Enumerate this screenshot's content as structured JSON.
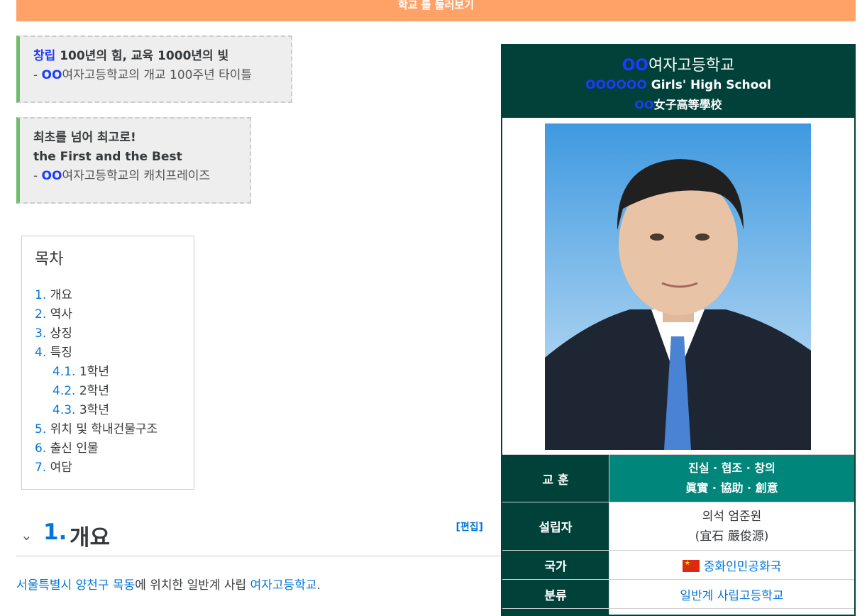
{
  "top_bar": {
    "label": "학교 를 둘러보기"
  },
  "quotes": [
    {
      "redacted": "창립",
      "bold_text": " 100년의 힘, 교육 1000년의 빛",
      "source_prefix": "- ",
      "source_redacted": "OO",
      "source_text": "여자고등학교의 개교 100주년 타이틀"
    },
    {
      "bold_line1": "최초를 넘어 최고로!",
      "bold_line2": "the First and the Best",
      "source_prefix": "- ",
      "source_redacted": "OO",
      "source_text": "여자고등학교의 캐치프레이즈"
    }
  ],
  "toc": {
    "title": "목차",
    "items": [
      {
        "num": "1.",
        "label": "개요"
      },
      {
        "num": "2.",
        "label": "역사"
      },
      {
        "num": "3.",
        "label": "상징"
      },
      {
        "num": "4.",
        "label": "특징"
      },
      {
        "num": "4.1.",
        "label": "1학년"
      },
      {
        "num": "4.2.",
        "label": "2학년"
      },
      {
        "num": "4.3.",
        "label": "3학년"
      },
      {
        "num": "5.",
        "label": "위치 및 학내건물구조"
      },
      {
        "num": "6.",
        "label": "출신 인물"
      },
      {
        "num": "7.",
        "label": "여담"
      }
    ]
  },
  "section1": {
    "num": "1.",
    "title": "개요",
    "edit_label": "[편집]"
  },
  "paragraph": {
    "link1": "서울특별시",
    "link2": "양천구",
    "link3": "목동",
    "text1": "에 위치한 일반계 사립 ",
    "link4": "여자고등학교",
    "text2": "."
  },
  "infobox": {
    "name_redacted": "OO",
    "name": "여자고등학교",
    "name_en_redacted": "OOOOOO",
    "name_en": " Girls' High School",
    "name_hanja_redacted": "OO",
    "name_hanja": "女子高等學校",
    "rows": {
      "motto_label": "교 훈",
      "motto_line1": "진실 · 협조 · 창의",
      "motto_line2": "眞實 · 協助 · 創意",
      "founder_label": "설립자",
      "founder_line1": "의석 엄준원",
      "founder_line2": "(宜石 嚴俊源)",
      "country_label": "국가",
      "country_value": "중화인민공화국",
      "type_label": "분류",
      "type_value": "일반계 사립고등학교"
    }
  },
  "colors": {
    "accent": "#00423a",
    "motto_bg": "#00867a",
    "top_bar": "#ffa268",
    "link": "#0275d8"
  }
}
